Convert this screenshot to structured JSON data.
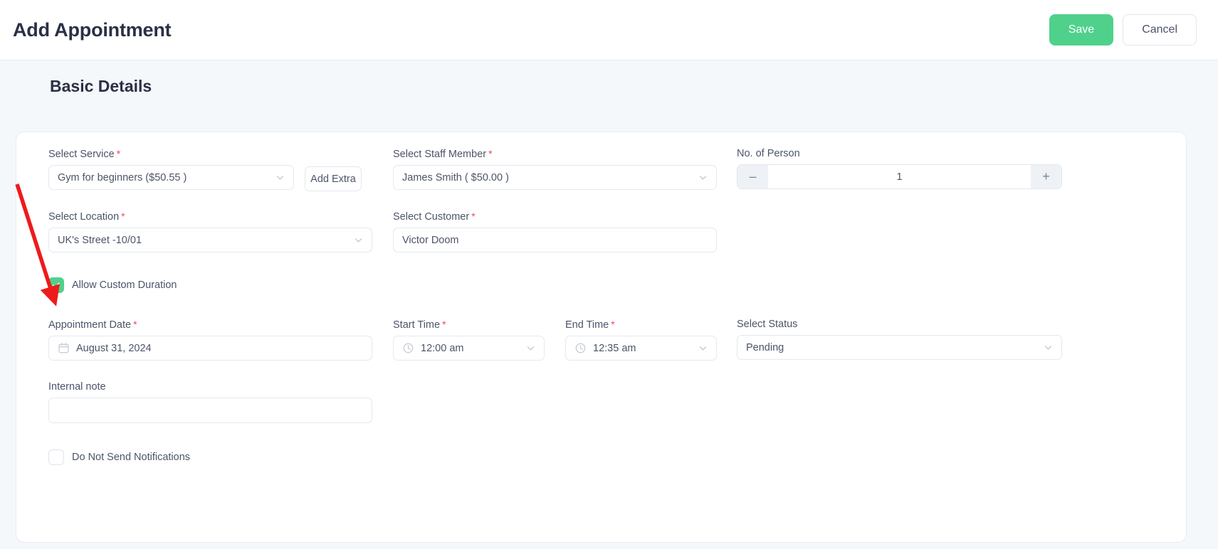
{
  "header": {
    "title": "Add Appointment",
    "save_label": "Save",
    "cancel_label": "Cancel",
    "save_color": "#4fd18b"
  },
  "section": {
    "title": "Basic Details"
  },
  "form": {
    "service": {
      "label": "Select Service",
      "required": "*",
      "value": "Gym for beginners ($50.55 )"
    },
    "add_extra": {
      "label": "Add Extra"
    },
    "staff": {
      "label": "Select Staff Member",
      "required": "*",
      "value": "James Smith ( $50.00 )"
    },
    "person": {
      "label": "No. of Person",
      "value": "1",
      "minus_label": "–",
      "plus_label": "+"
    },
    "location": {
      "label": "Select Location",
      "required": "*",
      "value": "UK's Street -10/01"
    },
    "customer": {
      "label": "Select Customer",
      "required": "*",
      "value": "Victor Doom"
    },
    "allow_custom_duration": {
      "label": "Allow Custom Duration",
      "checked": true
    },
    "appointment_date": {
      "label": "Appointment Date",
      "required": "*",
      "value": "August 31, 2024"
    },
    "start_time": {
      "label": "Start Time",
      "required": "*",
      "value": "12:00 am"
    },
    "end_time": {
      "label": "End Time",
      "required": "*",
      "value": "12:35 am"
    },
    "status": {
      "label": "Select Status",
      "value": "Pending"
    },
    "internal_note": {
      "label": "Internal note",
      "value": "",
      "placeholder": ""
    },
    "do_not_send_notifications": {
      "label": "Do Not Send Notifications",
      "checked": false
    }
  },
  "annotation": {
    "arrow_color": "#ee1b1b",
    "points_at": "Allow Custom Duration"
  }
}
